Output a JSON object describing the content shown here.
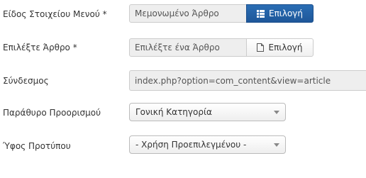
{
  "menu_item_type": {
    "label": "Είδος Στοιχείου Μενού *",
    "value": "Μεμονωμένο Άρθρο",
    "button_label": "Επιλογή",
    "button_icon": "list-icon",
    "accent_color": "#2a6db4"
  },
  "select_article": {
    "label": "Επιλέξτε Άρθρο *",
    "value": "Επιλέξτε ένα Άρθρο",
    "button_label": "Επιλογή",
    "button_icon": "file-icon"
  },
  "link": {
    "label": "Σύνδεσμος",
    "value": "index.php?option=com_content&view=article"
  },
  "target_window": {
    "label": "Παράθυρο Προορισμού",
    "selected": "Γονική Κατηγορία"
  },
  "template_style": {
    "label": "Ύφος Προτύπου",
    "selected": "- Χρήση Προεπιλεγμένου -"
  }
}
